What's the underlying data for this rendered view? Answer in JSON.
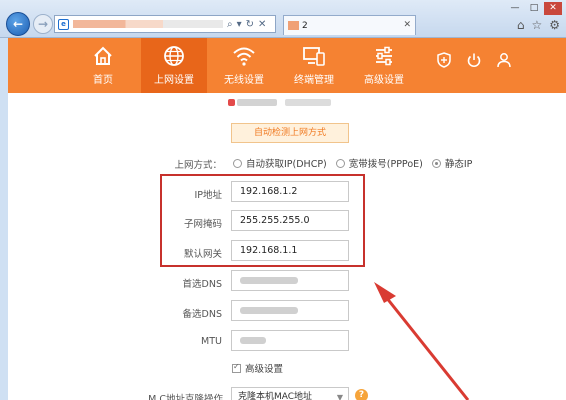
{
  "browser": {
    "address_url": "",
    "tab_title": "2",
    "window_buttons": [
      "—",
      "□",
      "✕"
    ]
  },
  "nav": {
    "items": [
      {
        "label": "首页",
        "icon": "home-icon"
      },
      {
        "label": "上网设置",
        "icon": "globe-icon",
        "active": true
      },
      {
        "label": "无线设置",
        "icon": "wifi-icon"
      },
      {
        "label": "终端管理",
        "icon": "devices-icon"
      },
      {
        "label": "高级设置",
        "icon": "sliders-icon"
      }
    ],
    "right_icons": [
      "shield-icon",
      "power-icon",
      "user-icon"
    ],
    "accent_color": "#f58232",
    "active_color": "#e8661a"
  },
  "page": {
    "detect_button": "自动检测上网方式",
    "connection_label": "上网方式：",
    "connection_options": [
      {
        "label": "自动获取IP(DHCP)",
        "checked": false
      },
      {
        "label": "宽带拨号(PPPoE)",
        "checked": false
      },
      {
        "label": "静态IP",
        "checked": true
      }
    ],
    "ip_label": "IP地址",
    "ip_value": "192.168.1.2",
    "mask_label": "子网掩码",
    "mask_value": "255.255.255.0",
    "gateway_label": "默认网关",
    "gateway_value": "192.168.1.1",
    "dns1_label": "首选DNS",
    "dns2_label": "备选DNS",
    "mtu_label": "MTU",
    "advanced_label": "高级设置",
    "mac_label": "M  C地址克隆操作",
    "mac_value": "克隆本机MAC地址",
    "help": "?"
  }
}
